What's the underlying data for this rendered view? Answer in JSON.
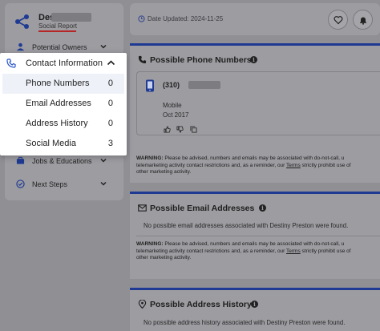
{
  "sidebar": {
    "name": "Des",
    "subtitle": "Social Report",
    "sections": [
      {
        "label": "Potential Owners"
      },
      {
        "label": "Jobs & Educations"
      },
      {
        "label": "Next Steps"
      }
    ]
  },
  "popup": {
    "title": "Contact Information",
    "items": [
      {
        "label": "Phone Numbers",
        "count": "0"
      },
      {
        "label": "Email Addresses",
        "count": "0"
      },
      {
        "label": "Address History",
        "count": "0"
      },
      {
        "label": "Social Media",
        "count": "3"
      }
    ]
  },
  "topbar": {
    "date_text": "Date Updated: 2024-11-25"
  },
  "phones": {
    "title": "Possible Phone Numbers",
    "number_prefix": "(310)",
    "type": "Mobile",
    "date": "Oct 2017",
    "warning_label": "WARNING:",
    "warning_line1": " Please be advised, numbers and emails may be associated with do-not-call, u",
    "warning_line2a": "telemarketing activity contact restrictions and, as a reminder, our ",
    "warning_terms": "Terms",
    "warning_line2b": " strictly prohibit use of",
    "warning_line3": "other marketing activity."
  },
  "emails": {
    "title": "Possible Email Addresses",
    "empty": "No possible email addresses associated with Destiny Preston were found.",
    "warning_label": "WARNING:",
    "warning_line1": " Please be advised, numbers and emails may be associated with do-not-call, u",
    "warning_line2a": "telemarketing activity contact restrictions and, as a reminder, our ",
    "warning_terms": "Terms",
    "warning_line2b": " strictly prohibit use of",
    "warning_line3": "other marketing activity."
  },
  "addresses": {
    "title": "Possible Address History",
    "empty": "No possible address history associated with Destiny Preston were found."
  },
  "colors": {
    "accent": "#1f3a92",
    "underline": "#b52626",
    "overlay_bg": "#8f8f94"
  }
}
